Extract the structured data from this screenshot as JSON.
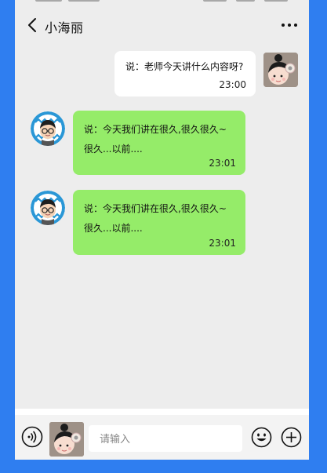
{
  "header": {
    "title": "小海丽",
    "back_icon": "chevron-left-icon",
    "more_icon": "more-dots-icon"
  },
  "messages": [
    {
      "side": "right",
      "avatar": "girl-avatar",
      "text": "说：老师今天讲什么内容呀?",
      "time": "23:00",
      "bubble_color": "#ffffff"
    },
    {
      "side": "left",
      "avatar": "boy-avatar",
      "text": "说：今天我们讲在很久,很久很久~很久...以前....",
      "time": "23:01",
      "bubble_color": "#95ec69"
    },
    {
      "side": "left",
      "avatar": "boy-avatar",
      "text": "说：今天我们讲在很久,很久很久~很久...以前....",
      "time": "23:01",
      "bubble_color": "#95ec69"
    }
  ],
  "input_bar": {
    "placeholder": "请输入",
    "voice_icon": "voice-icon",
    "emoji_icon": "emoji-icon",
    "plus_icon": "plus-circle-icon"
  },
  "colors": {
    "outer_background": "#2f7ef0",
    "chat_background": "#ededed",
    "green_bubble": "#95ec69",
    "white_bubble": "#ffffff"
  }
}
